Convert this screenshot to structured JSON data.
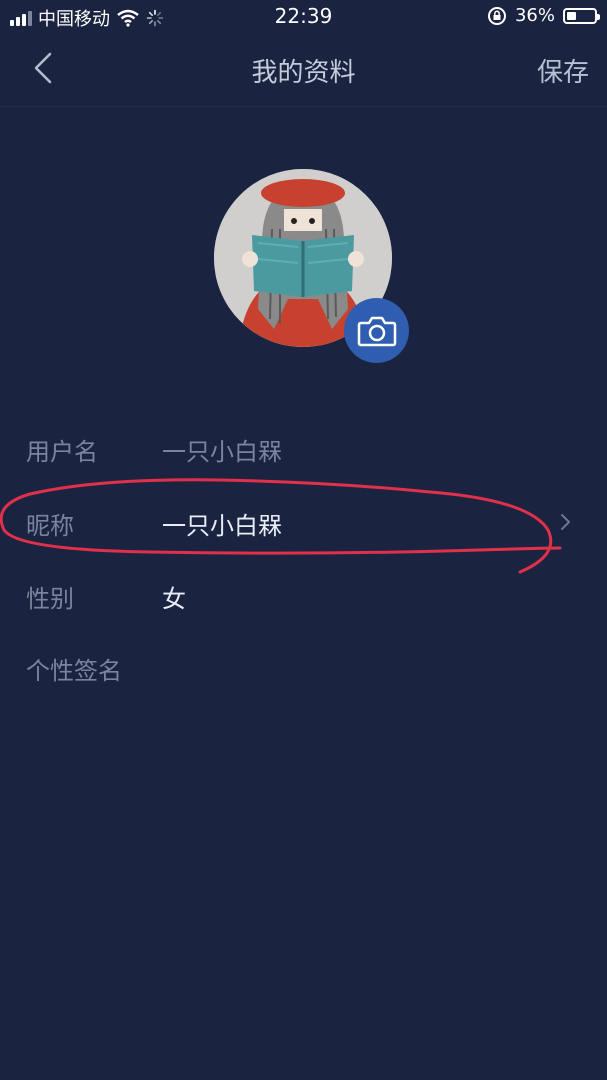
{
  "status_bar": {
    "carrier": "中国移动",
    "time": "22:39",
    "battery": "36%",
    "battery_level": 0.36
  },
  "nav": {
    "title": "我的资料",
    "save_label": "保存"
  },
  "profile": {
    "fields": [
      {
        "label": "用户名",
        "value": "一只小白槑"
      },
      {
        "label": "昵称",
        "value": "一只小白槑"
      },
      {
        "label": "性别",
        "value": "女"
      },
      {
        "label": "个性签名",
        "value": ""
      }
    ]
  },
  "colors": {
    "background": "#1a2440",
    "accent": "#2f5db0",
    "annotation": "#e0304a"
  }
}
